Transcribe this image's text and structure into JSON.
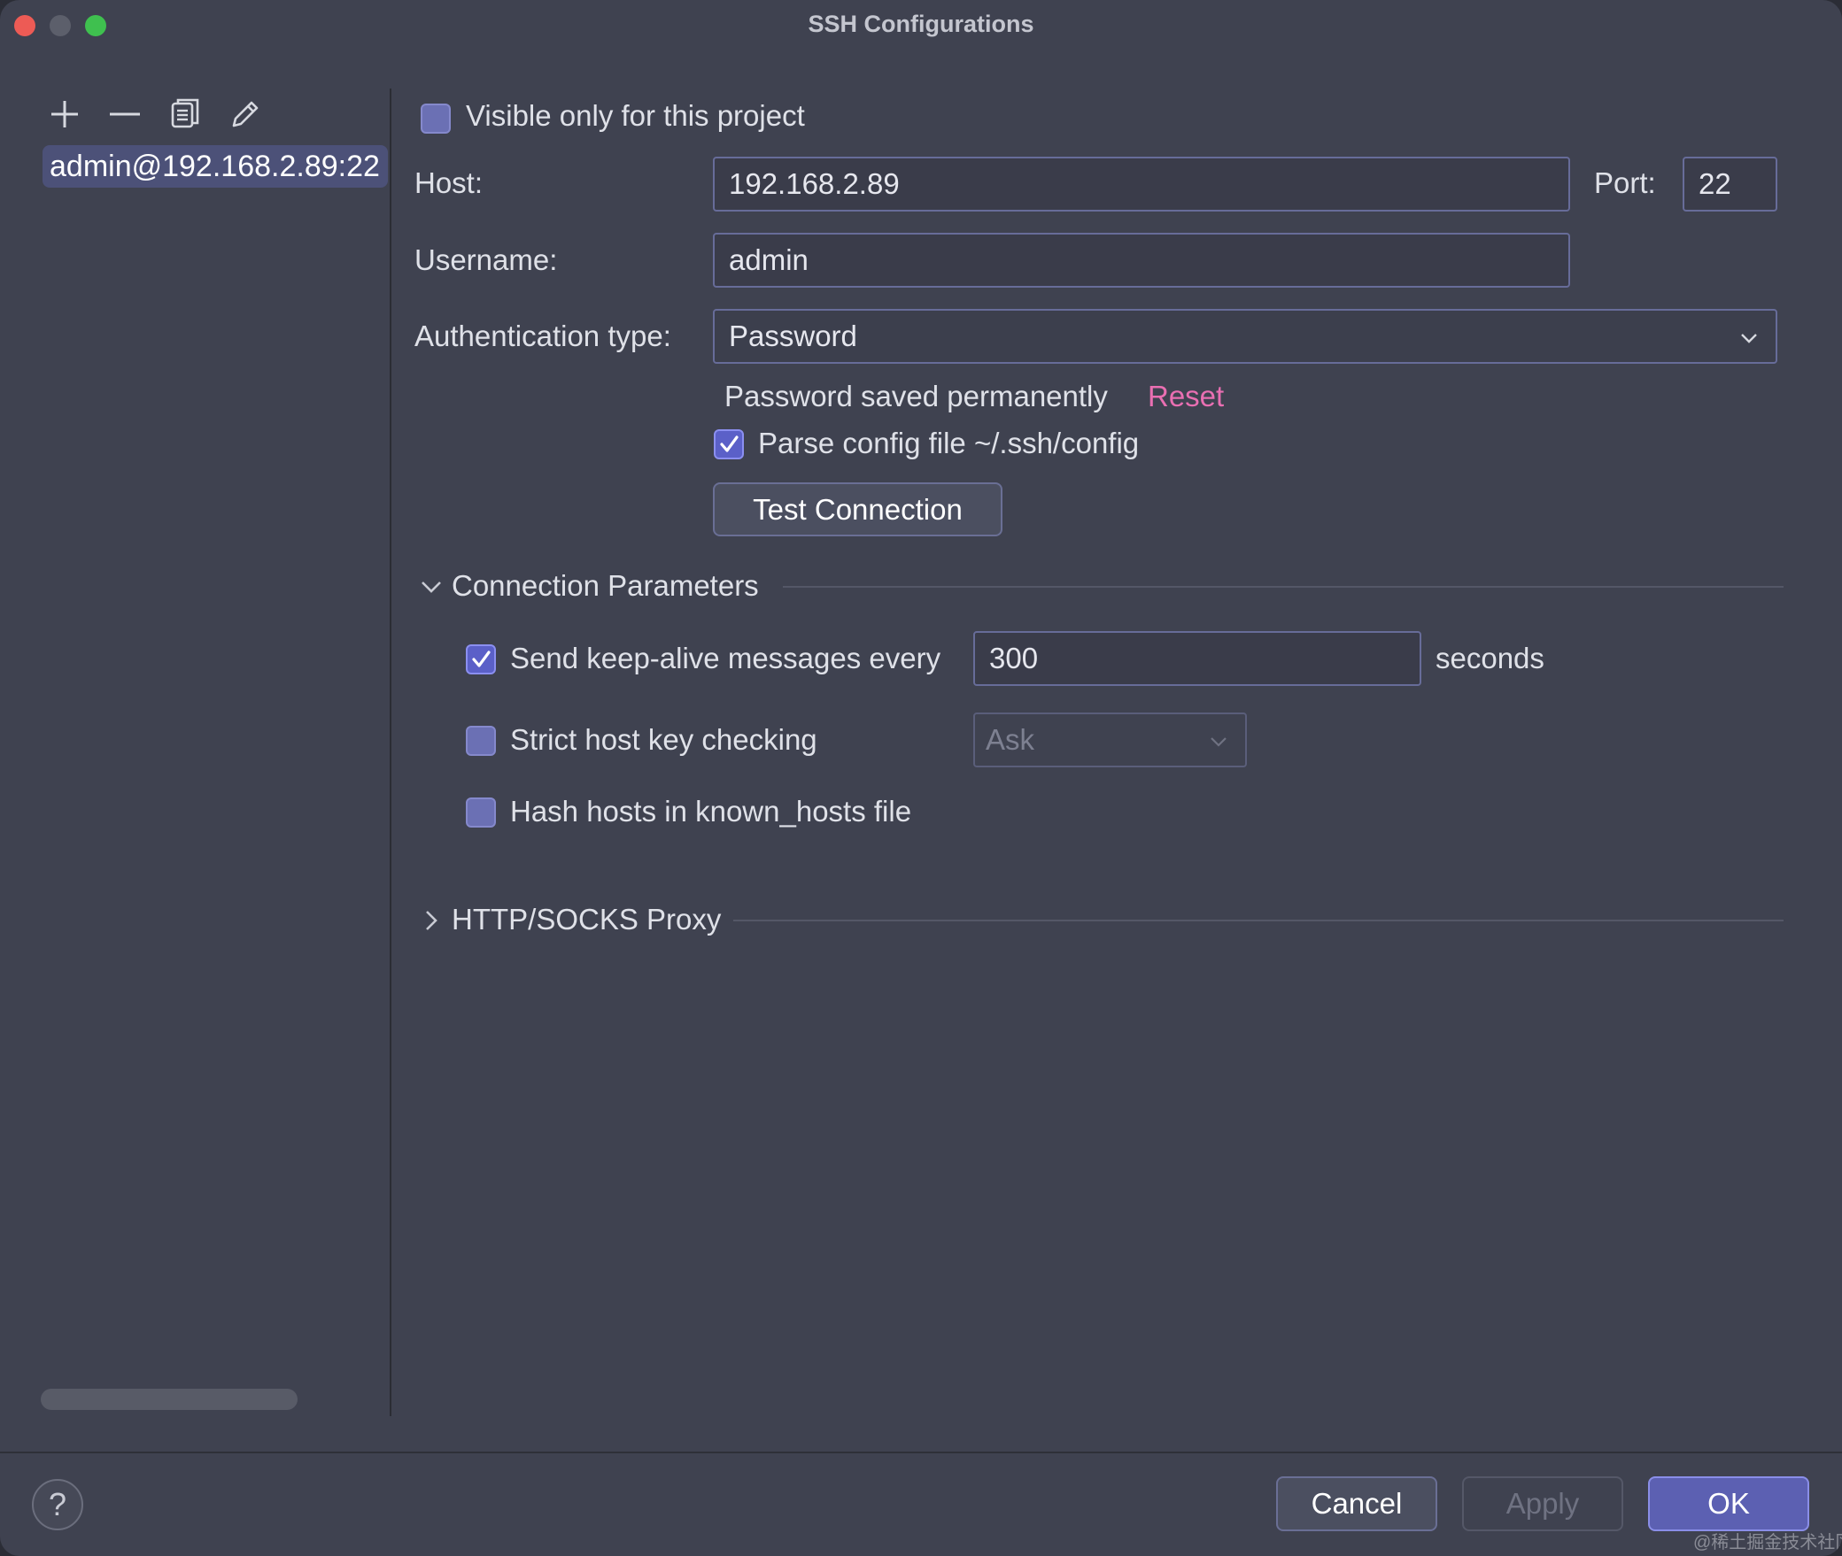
{
  "window": {
    "title": "SSH Configurations"
  },
  "sidebar": {
    "tools": [
      {
        "icon": "plus-icon"
      },
      {
        "icon": "minus-icon"
      },
      {
        "icon": "copy-icon"
      },
      {
        "icon": "edit-icon"
      }
    ],
    "items": [
      {
        "label": "admin@192.168.2.89:22",
        "selected": true
      }
    ]
  },
  "form": {
    "visible_only_label": "Visible only for this project",
    "visible_only_checked": false,
    "host_label": "Host:",
    "host_value": "192.168.2.89",
    "port_label": "Port:",
    "port_value": "22",
    "username_label": "Username:",
    "username_value": "admin",
    "auth_label": "Authentication type:",
    "auth_value": "Password",
    "password_status": "Password saved permanently",
    "reset_link": "Reset",
    "parse_config_label": "Parse config file ~/.ssh/config",
    "parse_config_checked": true,
    "test_button": "Test Connection"
  },
  "connection_params": {
    "title": "Connection Parameters",
    "expanded": true,
    "keepalive_label": "Send keep-alive messages every",
    "keepalive_checked": true,
    "keepalive_value": "300",
    "keepalive_unit": "seconds",
    "strict_label": "Strict host key checking",
    "strict_checked": false,
    "strict_value": "Ask",
    "hash_label": "Hash hosts in known_hosts file",
    "hash_checked": false
  },
  "proxy": {
    "title": "HTTP/SOCKS Proxy",
    "expanded": false
  },
  "footer": {
    "help": "?",
    "cancel": "Cancel",
    "apply": "Apply",
    "ok": "OK"
  },
  "watermark": "@稀土掘金技术社区",
  "colors": {
    "background": "#3f4250",
    "accent": "#5c60b2",
    "link": "#e96fb2"
  }
}
